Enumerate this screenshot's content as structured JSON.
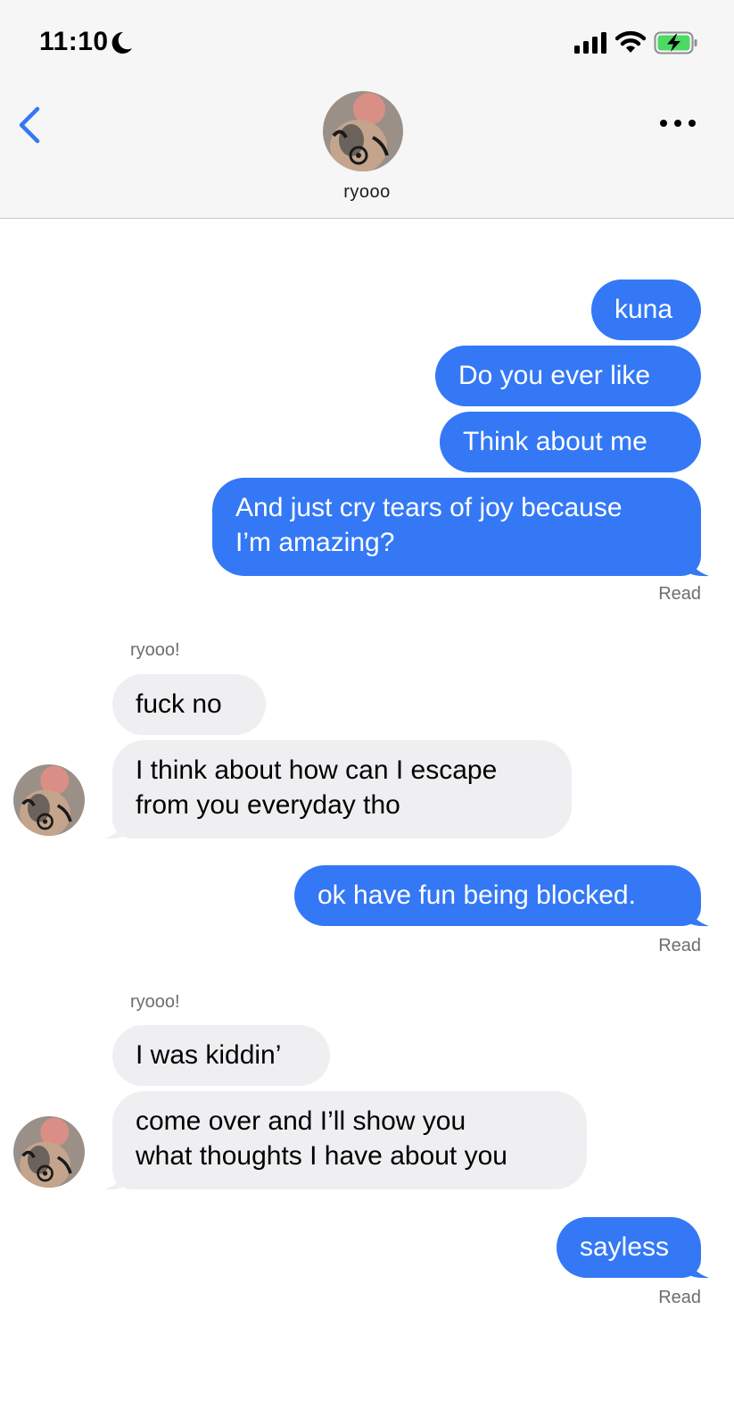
{
  "status_bar": {
    "time": "11:10"
  },
  "header": {
    "contact_name": "ryooo"
  },
  "messages": [
    {
      "text": "kuna"
    },
    {
      "text": "Do you ever like"
    },
    {
      "text": "Think about me"
    },
    {
      "line1": "And just cry tears of joy because",
      "line2": "I’m amazing?"
    },
    {
      "read": "Read"
    },
    {
      "sender": "ryooo!"
    },
    {
      "text": "fuck no"
    },
    {
      "line1": "I think about how can I escape",
      "line2": "from you everyday tho"
    },
    {
      "text": "ok have fun being blocked."
    },
    {
      "read": "Read"
    },
    {
      "sender": "ryooo!"
    },
    {
      "text": "I was kiddin’"
    },
    {
      "line1": "come over and I’ll show you",
      "line2": "what thoughts I have about you"
    },
    {
      "text": "sayless"
    },
    {
      "read": "Read"
    }
  ],
  "colors": {
    "outgoing": "#3478f6",
    "incoming": "#efeff1",
    "accent": "#3478f6"
  },
  "icons": [
    "moon-icon",
    "cellular-signal-icon",
    "wifi-icon",
    "battery-charging-icon",
    "back-chevron-icon",
    "more-icon"
  ]
}
